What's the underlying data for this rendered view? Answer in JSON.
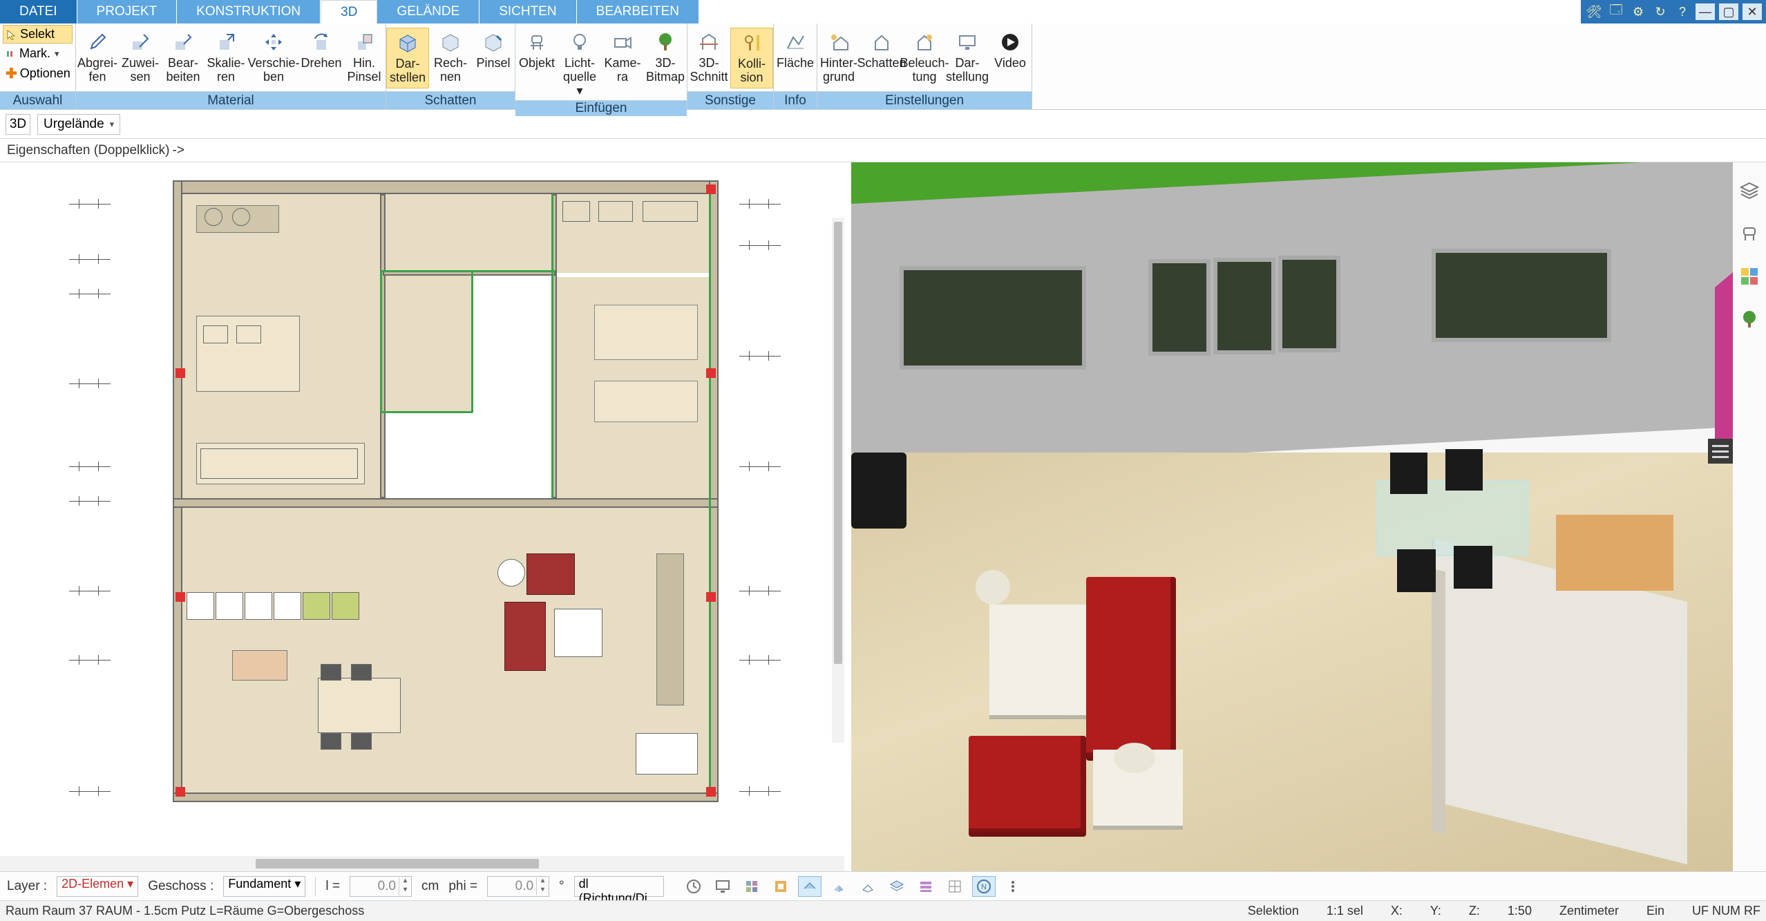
{
  "menu": {
    "tabs": [
      "DATEI",
      "PROJEKT",
      "KONSTRUKTION",
      "3D",
      "GELÄNDE",
      "SICHTEN",
      "BEARBEITEN"
    ],
    "active": "3D",
    "window_icons": [
      "wrench",
      "save",
      "settings",
      "updates",
      "help",
      "min",
      "max",
      "close"
    ]
  },
  "auswahl": {
    "selekt": "Selekt",
    "mark": "Mark.",
    "optionen": "Optionen",
    "label": "Auswahl"
  },
  "ribbon": {
    "groups": [
      {
        "label": "Material",
        "items": [
          {
            "id": "abgreifen",
            "l1": "Abgrei-",
            "l2": "fen"
          },
          {
            "id": "zuweisen",
            "l1": "Zuwei-",
            "l2": "sen"
          },
          {
            "id": "bearbeiten",
            "l1": "Bear-",
            "l2": "beiten"
          },
          {
            "id": "skalieren",
            "l1": "Skalie-",
            "l2": "ren"
          },
          {
            "id": "verschieben",
            "l1": "Verschie-",
            "l2": "ben"
          },
          {
            "id": "drehen",
            "l1": "Drehen",
            "l2": ""
          },
          {
            "id": "hinpinsel",
            "l1": "Hin.",
            "l2": "Pinsel"
          }
        ]
      },
      {
        "label": "Schatten",
        "items": [
          {
            "id": "darstellen",
            "l1": "Dar-",
            "l2": "stellen"
          },
          {
            "id": "rechnen",
            "l1": "Rech-",
            "l2": "nen"
          },
          {
            "id": "pinsel",
            "l1": "Pinsel",
            "l2": ""
          }
        ]
      },
      {
        "label": "Einfügen",
        "items": [
          {
            "id": "objekt",
            "l1": "Objekt",
            "l2": ""
          },
          {
            "id": "lichtquelle",
            "l1": "Licht-",
            "l2": "quelle ▾"
          },
          {
            "id": "kamera",
            "l1": "Kame-",
            "l2": "ra"
          },
          {
            "id": "3dbitmap",
            "l1": "3D-",
            "l2": "Bitmap"
          }
        ]
      },
      {
        "label": "Sonstige",
        "items": [
          {
            "id": "3dschnitt",
            "l1": "3D-",
            "l2": "Schnitt"
          },
          {
            "id": "kollision",
            "l1": "Kolli-",
            "l2": "sion"
          }
        ]
      },
      {
        "label": "Info",
        "items": [
          {
            "id": "flaeche",
            "l1": "Fläche",
            "l2": ""
          }
        ]
      },
      {
        "label": "Einstellungen",
        "items": [
          {
            "id": "hintergrund",
            "l1": "Hinter-",
            "l2": "grund"
          },
          {
            "id": "schatten",
            "l1": "Schatten",
            "l2": ""
          },
          {
            "id": "beleuchtung",
            "l1": "Beleuch-",
            "l2": "tung"
          },
          {
            "id": "darstellung",
            "l1": "Dar-",
            "l2": "stellung"
          },
          {
            "id": "video",
            "l1": "Video",
            "l2": ""
          }
        ]
      }
    ],
    "active_items": [
      "darstellen",
      "kollision"
    ]
  },
  "subbar": {
    "viewmode": "3D",
    "gelaende": "Urgelände"
  },
  "propbar": {
    "text": "Eigenschaften (Doppelklick)",
    "arrow": "->"
  },
  "bottom": {
    "layer_label": "Layer :",
    "layer_value": "2D-Elemen",
    "geschoss_label": "Geschoss :",
    "geschoss_value": "Fundament",
    "l_label": "l =",
    "l_value": "0.0",
    "unit": "cm",
    "phi_label": "phi =",
    "phi_value": "0.0",
    "deg": "°",
    "dl_value": "dl (Richtung/Di",
    "icons": [
      "clock",
      "monitor",
      "grid3d",
      "palette",
      "ortho",
      "iso-left",
      "iso-right",
      "layers",
      "stack",
      "grid",
      "north",
      "more"
    ]
  },
  "status": {
    "left": "Raum Raum 37 RAUM - 1.5cm Putz L=Räume G=Obergeschoss",
    "selektion": "Selektion",
    "sel": "1:1 sel",
    "x": "X:",
    "y": "Y:",
    "z": "Z:",
    "scale": "1:50",
    "unit": "Zentimeter",
    "ein": "Ein",
    "flags": "UF  NUM RF"
  },
  "rail_icons": [
    "layers",
    "chair",
    "palette-grid",
    "tree"
  ]
}
